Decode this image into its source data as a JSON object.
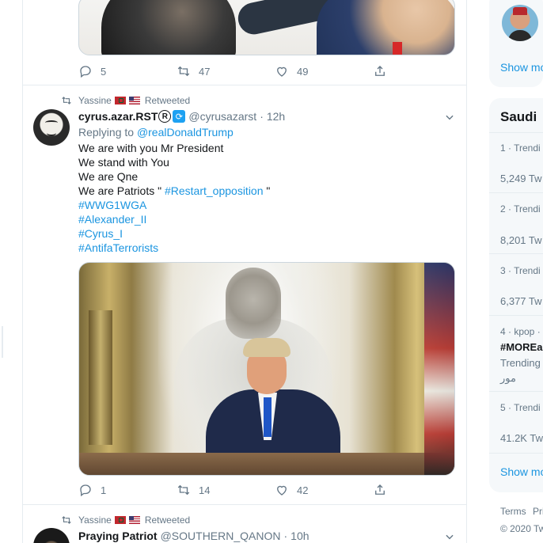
{
  "previous_tweet": {
    "actions": {
      "reply_count": "5",
      "retweet_count": "47",
      "like_count": "49"
    }
  },
  "tweet": {
    "retweet_context": {
      "user": "Yassine",
      "label": "Retweeted"
    },
    "author": {
      "name": "cyrus.azar.RST",
      "registered_mark": "R",
      "handle": "@cyrusazarst",
      "time": "12h"
    },
    "reply_to": {
      "prefix": "Replying to",
      "mention": "@realDonaldTrump"
    },
    "text": {
      "line1": "We are with you Mr President",
      "line2": "We stand with You",
      "line3": "We are Qne",
      "line4_prefix": "We are Patriots \"",
      "line4_hashtag": "#Restart_opposition",
      "line4_suffix": "\"",
      "hashtag1": "#WWG1WGA",
      "hashtag2": "#Alexander_II",
      "hashtag3": "#Cyrus_I",
      "hashtag4": "#AntifaTerrorists"
    },
    "actions": {
      "reply_count": "1",
      "retweet_count": "14",
      "like_count": "42"
    }
  },
  "next_tweet": {
    "retweet_context": {
      "user": "Yassine",
      "label": "Retweeted"
    },
    "author": {
      "name": "Praying Patriot",
      "handle": "@SOUTHERN_QANON",
      "time": "10h"
    }
  },
  "sidebar": {
    "who_to_follow": {
      "show_more": "Show mo"
    },
    "trends": {
      "title": "Saudi",
      "items": [
        {
          "meta": "1 · Trendi",
          "count": "5,249 Tw"
        },
        {
          "meta": "2 · Trendi",
          "count": "8,201 Tw"
        },
        {
          "meta": "3 · Trendi",
          "count": "6,377 Tw"
        },
        {
          "meta": "4 · kpop ·",
          "name": "#MOREa",
          "sub": "Trending",
          "extra": "مور"
        },
        {
          "meta": "5 · Trendi",
          "count": "41.2K Tw"
        }
      ],
      "show_more": "Show mo"
    },
    "footer": {
      "terms": "Terms",
      "privacy": "Pri",
      "copyright": "© 2020 Tw"
    }
  },
  "colors": {
    "accent": "#1b95e0",
    "muted": "#657786",
    "text": "#14171a",
    "border": "#e6ecf0",
    "sidebar_bg": "#f5f8fa"
  }
}
